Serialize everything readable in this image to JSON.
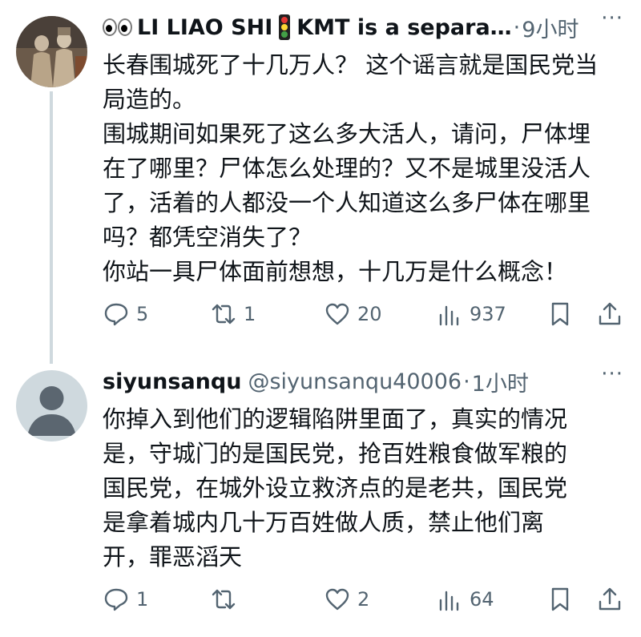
{
  "tweets": [
    {
      "author": {
        "name": "LI LIAO SHI",
        "name_suffix": "KMT is a separa…",
        "time": "9小时"
      },
      "lines": [
        "长春围城死了十几万人？ 这个谣言就是国民党当",
        "局造的。",
        "围城期间如果死了这么多大活人，请问，尸体埋",
        "在了哪里？尸体怎么处理的？又不是城里没活人",
        "了，活着的人都没一个人知道这么多尸体在哪里",
        "吗？都凭空消失了？",
        "你站一具尸体面前想想，十几万是什么概念！"
      ],
      "stats": {
        "replies": "5",
        "reposts": "1",
        "likes": "20",
        "views": "937"
      }
    },
    {
      "author": {
        "name": "siyunsanqu",
        "handle": "@siyunsanqu40006",
        "time": "1小时"
      },
      "lines": [
        "你掉入到他们的逻辑陷阱里面了，真实的情况",
        "是，守城门的是国民党，抢百姓粮食做军粮的",
        "国民党，在城外设立救济点的是老共，国民党",
        "是拿着城内几十万百姓做人质，禁止他们离",
        "开，罪恶滔天"
      ],
      "stats": {
        "replies": "1",
        "reposts": "",
        "likes": "2",
        "views": "64"
      }
    }
  ],
  "ui": {
    "separator": "·",
    "more": "···"
  }
}
